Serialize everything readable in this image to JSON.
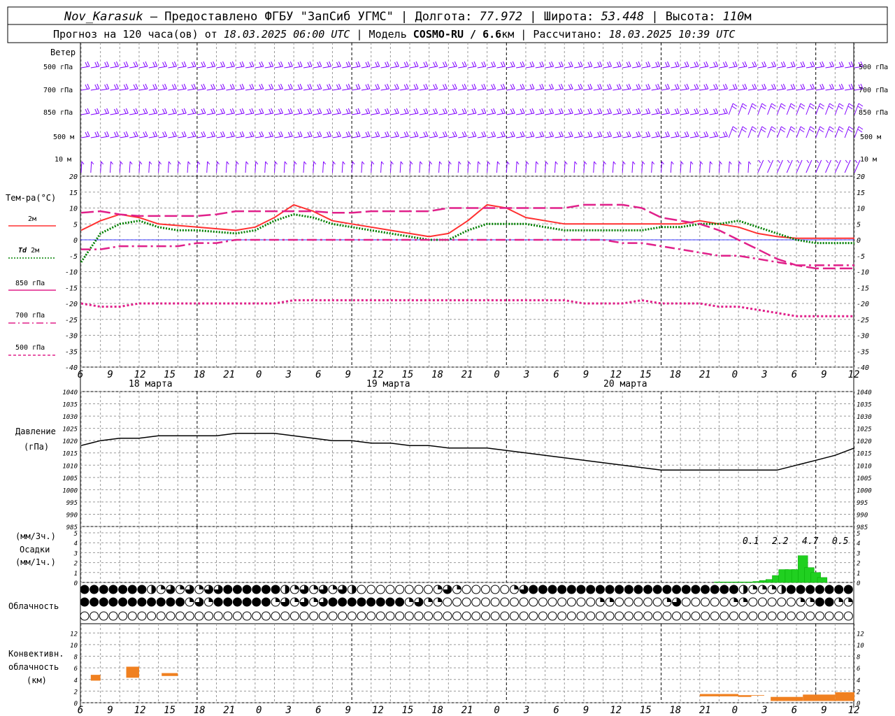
{
  "header": {
    "line1": {
      "station": "Nov_Karasuk",
      "provider": " – Предоставлено ФГБУ \"ЗапСиб УГМС\" | Долгота: ",
      "lon": "77.972",
      "lat_label": " | Широта: ",
      "lat": "53.448",
      "alt_label": " | Высота: ",
      "alt": "110",
      "alt_unit": "м"
    },
    "line2": {
      "prefix": "Прогноз на 120 часа(ов) от ",
      "start": "18.03.2025 06:00 UTC",
      "model_label": " | Модель ",
      "model": "COSMO-RU / 6.6",
      "model_unit": "км",
      "calc_label": " | Рассчитано: ",
      "calc": "18.03.2025 10:39 UTC"
    }
  },
  "labels": {
    "wind": "Ветер",
    "lev500": "500 гПа",
    "lev700": "700 гПа",
    "lev850": "850 гПа",
    "lev500m": "500 м",
    "lev10m": "10 м",
    "temp": "Тем-ра(°C)",
    "t2m": "2м",
    "td2m_a": "Td",
    "td2m_b": "2м",
    "t850": "850 гПа",
    "t700": "700 гПа",
    "t500": "500 гПа",
    "pressure": "Давление",
    "pressure_unit": "(гПа)",
    "precip_top": "(мм/3ч.)",
    "precip_mid": "Осадки",
    "precip_bot": "(мм/1ч.)",
    "clouds": "Облачность",
    "conv1": "Конвективн.",
    "conv2": "облачность",
    "conv3": "(км)"
  },
  "colors": {
    "wind": "#8000ff",
    "t2m": "#ff3030",
    "td2m": "#008000",
    "t850": "#e0208a",
    "t700": "#e0208a",
    "t500": "#e0208a",
    "precip": "#20d020",
    "conv": "#f08020",
    "zero": "#0000ff",
    "grid": "#999999"
  },
  "chart_data": [
    {
      "type": "line",
      "name": "temperature",
      "x_hours": [
        0,
        3,
        6,
        9,
        12,
        15,
        18,
        21,
        24,
        27,
        30,
        33,
        36,
        39,
        42,
        45,
        48,
        51,
        54,
        57,
        60,
        63,
        66,
        69,
        72,
        75,
        78,
        81,
        84,
        87,
        90,
        93,
        96,
        99,
        102,
        105,
        108,
        111,
        114,
        117,
        120
      ],
      "ylim": [
        -40,
        20
      ],
      "yticks": [
        20,
        15,
        10,
        5,
        0,
        -5,
        -10,
        -15,
        -20,
        -25,
        -30,
        -35,
        -40
      ],
      "series": [
        {
          "name": "2м",
          "values": [
            3,
            6,
            8,
            7,
            5,
            4.5,
            4,
            3.5,
            3,
            4,
            7,
            11,
            9,
            6,
            5,
            4,
            3,
            2,
            1,
            2,
            6,
            11,
            10,
            7,
            6,
            5,
            5,
            5,
            5,
            5,
            5,
            5,
            6,
            5,
            4,
            2,
            1,
            0.5,
            0.5,
            0.5,
            0.5
          ]
        },
        {
          "name": "Td 2м",
          "values": [
            -7,
            2,
            5,
            6,
            4,
            3,
            3,
            2.5,
            2,
            3,
            6,
            8,
            7,
            5,
            4,
            3,
            2,
            1,
            0,
            0,
            3,
            5,
            5,
            5,
            4,
            3,
            3,
            3,
            3,
            3,
            4,
            4,
            5,
            5,
            6,
            4,
            2,
            0,
            -1,
            -1,
            -1
          ]
        },
        {
          "name": "850 гПа",
          "values": [
            8.5,
            9,
            8,
            7.5,
            7.5,
            7.5,
            7.5,
            8,
            9,
            9,
            9,
            9,
            9,
            8.5,
            8.5,
            9,
            9,
            9,
            9,
            10,
            10,
            10,
            10,
            10,
            10,
            10,
            11,
            11,
            11,
            10,
            7,
            6,
            5,
            3,
            0,
            -3,
            -6,
            -8,
            -9,
            -9,
            -9
          ]
        },
        {
          "name": "700 гПа",
          "values": [
            -3,
            -3,
            -2,
            -2,
            -2,
            -2,
            -1,
            -1,
            0,
            0,
            0,
            0,
            0,
            0,
            0,
            0,
            0,
            0,
            0,
            0,
            0,
            0,
            0,
            0,
            0,
            0,
            0,
            0,
            -1,
            -1,
            -2,
            -3,
            -4,
            -5,
            -5,
            -6,
            -7,
            -8,
            -8,
            -8,
            -8
          ]
        },
        {
          "name": "500 гПа",
          "values": [
            -20,
            -21,
            -21,
            -20,
            -20,
            -20,
            -20,
            -20,
            -20,
            -20,
            -20,
            -19,
            -19,
            -19,
            -19,
            -19,
            -19,
            -19,
            -19,
            -19,
            -19,
            -19,
            -19,
            -19,
            -19,
            -19,
            -20,
            -20,
            -20,
            -19,
            -20,
            -20,
            -20,
            -21,
            -21,
            -22,
            -23,
            -24,
            -24,
            -24,
            -24
          ]
        }
      ]
    },
    {
      "type": "line",
      "name": "pressure",
      "ylim": [
        985,
        1040
      ],
      "yticks": [
        1040,
        1035,
        1030,
        1025,
        1020,
        1015,
        1010,
        1005,
        1000,
        995,
        990,
        985
      ],
      "x_hours": [
        0,
        3,
        6,
        9,
        12,
        15,
        18,
        21,
        24,
        27,
        30,
        33,
        36,
        39,
        42,
        45,
        48,
        51,
        54,
        57,
        60,
        63,
        66,
        69,
        72,
        75,
        78,
        81,
        84,
        87,
        90,
        93,
        96,
        99,
        102,
        105,
        108,
        111,
        114,
        117,
        120
      ],
      "values": [
        1018,
        1020,
        1021,
        1021,
        1022,
        1022,
        1022,
        1022,
        1023,
        1023,
        1023,
        1022,
        1021,
        1020,
        1020,
        1019,
        1019,
        1018,
        1018,
        1017,
        1017,
        1017,
        1016,
        1015,
        1014,
        1013,
        1012,
        1011,
        1010,
        1009,
        1008,
        1008,
        1008,
        1008,
        1008,
        1008,
        1008,
        1010,
        1012,
        1014,
        1017
      ]
    },
    {
      "type": "bar",
      "name": "precipitation",
      "ylim": [
        0,
        5
      ],
      "yticks": [
        5,
        4,
        3,
        2,
        1,
        0
      ],
      "labels": [
        "0.1",
        "2.2",
        "4.7",
        "0.5"
      ],
      "x_hours": [
        99,
        100,
        101,
        102,
        103,
        104,
        105,
        106,
        107,
        108,
        109,
        110,
        111,
        112,
        113,
        114,
        115
      ],
      "values": [
        0.05,
        0.05,
        0.05,
        0.05,
        0.05,
        0.05,
        0.1,
        0.2,
        0.3,
        0.7,
        1.3,
        1.3,
        1.3,
        2.7,
        1.5,
        1.0,
        0.5
      ]
    },
    {
      "type": "bar",
      "name": "convective cloudiness",
      "ylim": [
        0,
        12
      ],
      "yticks": [
        12,
        10,
        8,
        6,
        4,
        2,
        0
      ],
      "bars": [
        {
          "x0": 1.5,
          "x1": 3,
          "base": 3.8,
          "top": 4.8
        },
        {
          "x0": 7,
          "x1": 9,
          "base": 4.3,
          "top": 6.2
        },
        {
          "x0": 12.5,
          "x1": 15,
          "base": 4.6,
          "top": 5.1
        },
        {
          "x0": 96,
          "x1": 102,
          "base": 1.1,
          "top": 1.5
        },
        {
          "x0": 102,
          "x1": 104,
          "base": 1.0,
          "top": 1.3
        },
        {
          "x0": 104,
          "x1": 106,
          "base": 1.2,
          "top": 1.3
        },
        {
          "x0": 107,
          "x1": 112,
          "base": 0.3,
          "top": 1.0
        },
        {
          "x0": 112,
          "x1": 117,
          "base": 0.3,
          "top": 1.4
        },
        {
          "x0": 117,
          "x1": 120,
          "base": 0.3,
          "top": 1.8
        }
      ]
    }
  ],
  "axis": {
    "hour_ticks": [
      "6",
      "9",
      "12",
      "15",
      "18",
      "21",
      "0",
      "3",
      "6",
      "9",
      "12",
      "15",
      "18",
      "21",
      "0",
      "3",
      "6",
      "9",
      "12",
      "15",
      "18",
      "21",
      "0",
      "3",
      "6",
      "9",
      "12"
    ],
    "dates": [
      "18 марта",
      "19 марта",
      "20 марта"
    ]
  },
  "clouds_rows": {
    "row1": "fffffffhqtqtqttffffffhqtqtqthooooooooqtqoooooqtffffffffffffffffffffffhqqqhffffffffqqqqqhqqooqhfffffoofffoqh",
    "row2": "fffffffffffqtqffffffqtqtqtffffffffqtqqooooooooooooooooqqoooooqtoooooqqoooooqqffqqqqoooooooffffffffffqqqfffffoofffffffqo",
    "row3": "ooooooooooooooooooooooooooooooooooooooooooooooooooooooooooooooooooooooooooooooooooooooooooooooooooooooooofffffffffffffffffq"
  }
}
